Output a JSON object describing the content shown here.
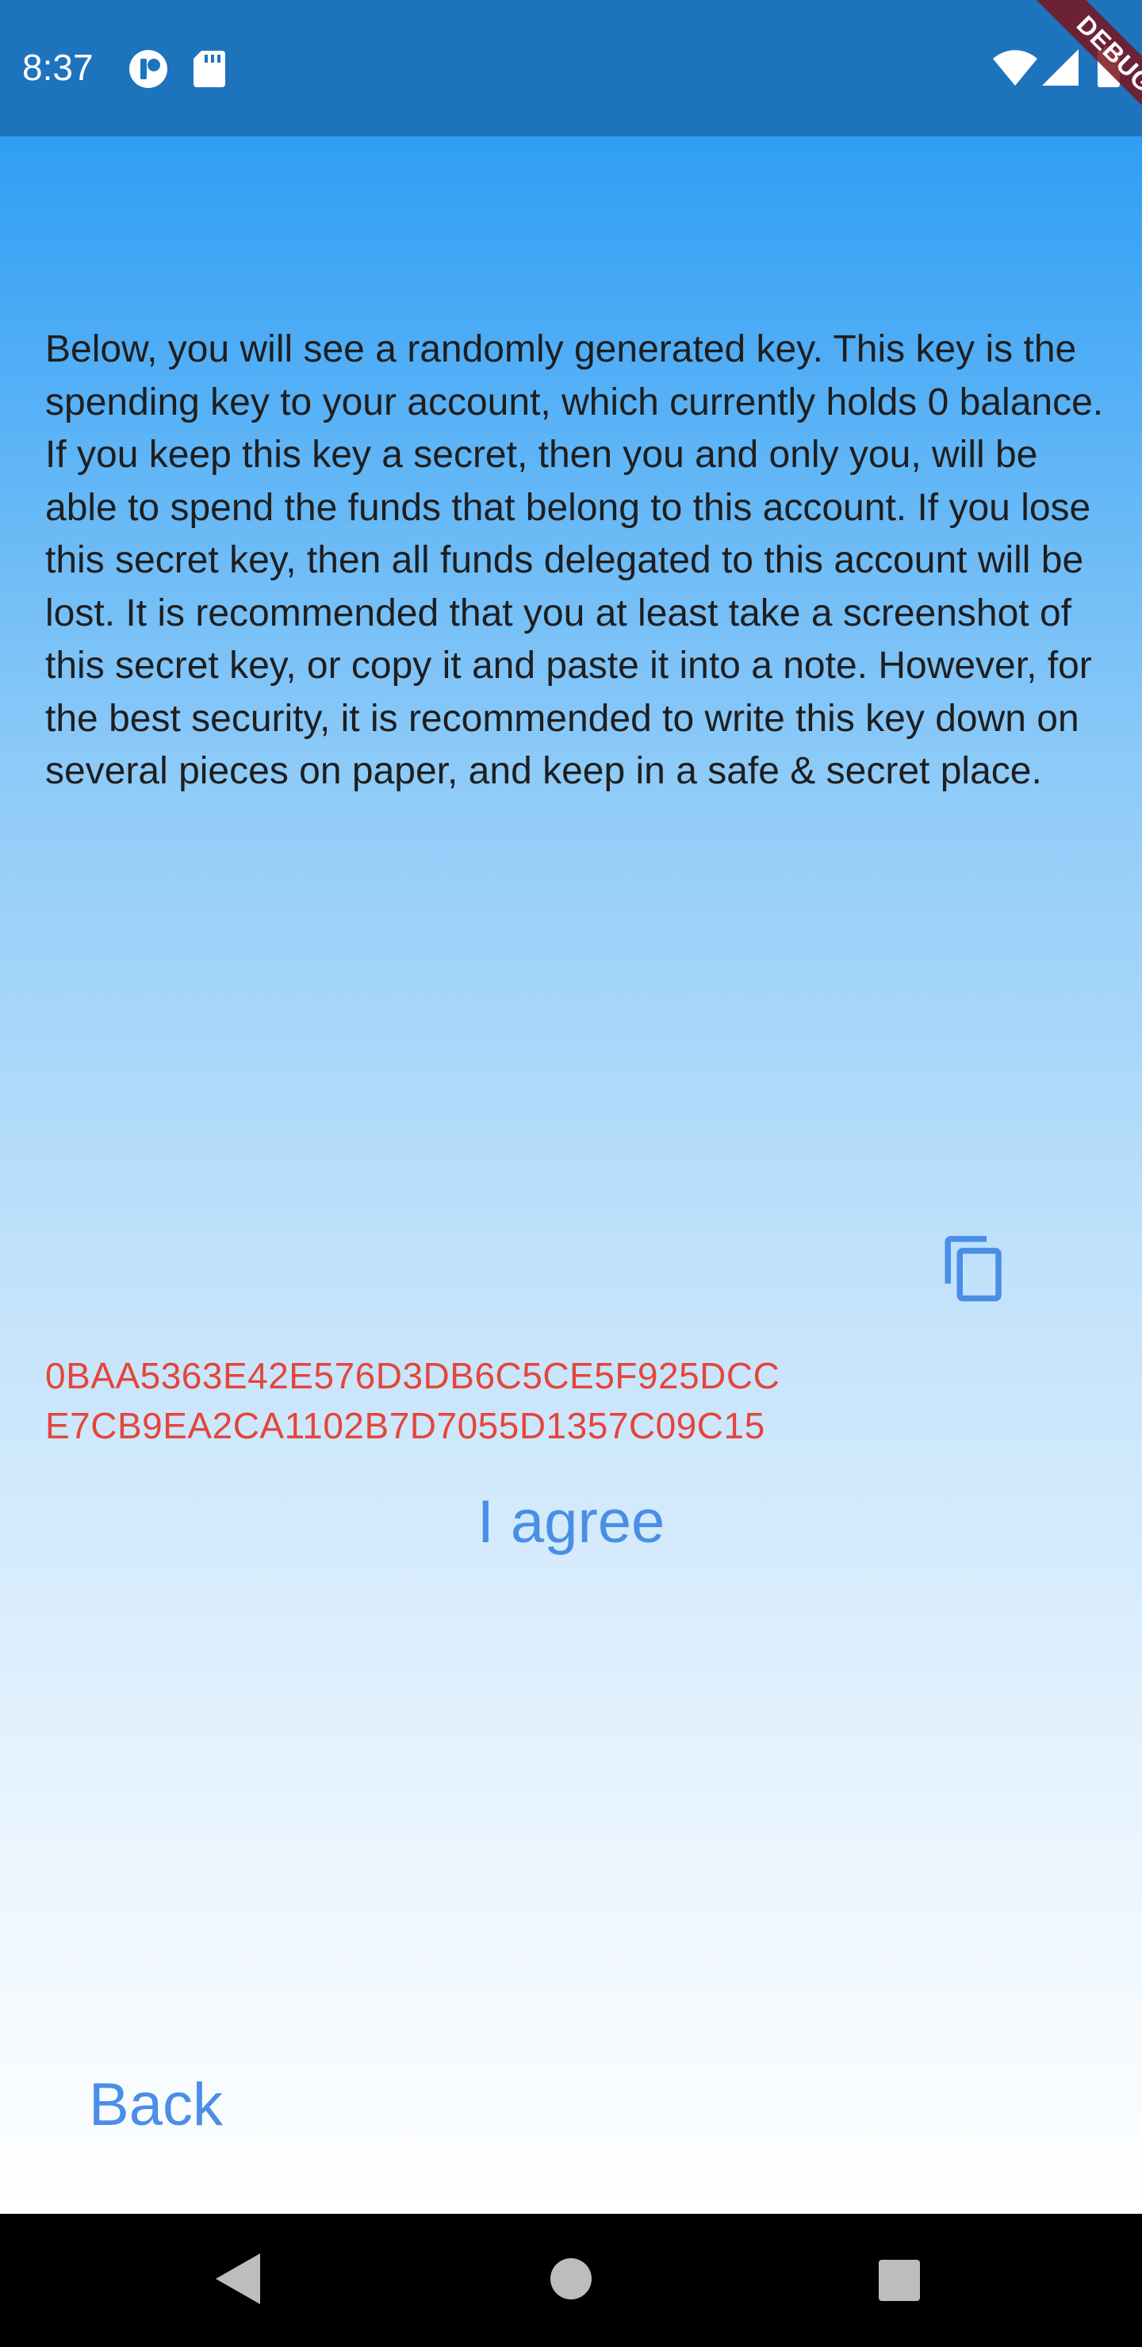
{
  "status_bar": {
    "time": "8:37",
    "left_icons": [
      "notification-app-icon",
      "sd-card-icon"
    ],
    "right_icons": [
      "wifi-icon",
      "signal-icon",
      "battery-icon"
    ],
    "debug_label": "DEBUG"
  },
  "main": {
    "intro_text": "Below, you will see a randomly generated key. This key is the spending key to your account, which currently holds 0 balance. If you keep this key a secret, then you and only you, will be able to spend the funds that belong to this account. If you lose this secret key, then all funds delegated to this account will be lost. It is recommended that you at least take a screenshot of this secret key, or copy it and paste it into a note. However, for the best security, it is recommended to write this key down on several pieces on paper, and keep in a safe & secret place.",
    "key_line_1": "0BAA5363E42E576D3DB6C5CE5F925DCC",
    "key_line_2": "E7CB9EA2CA1102B7D7055D1357C09C15",
    "copy_icon": "copy-icon",
    "agree_label": "I agree",
    "back_label": "Back"
  },
  "nav_bar": {
    "icons": [
      "back-triangle-icon",
      "home-circle-icon",
      "recents-square-icon"
    ]
  },
  "colors": {
    "status_bar": "#1e73bd",
    "gradient_top": "#2f9ef4",
    "key_text": "#e5453a",
    "button_text": "#4a8ee6"
  }
}
